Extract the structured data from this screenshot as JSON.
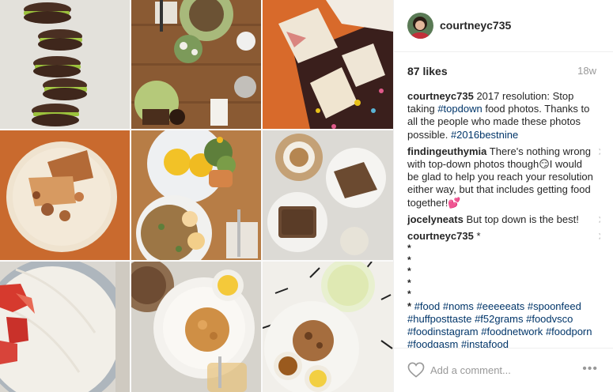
{
  "post": {
    "username": "courtneyc735",
    "likes": "87 likes",
    "age": "18w"
  },
  "grid": {
    "photos": [
      {
        "icon": "cookie-sandwich-photo"
      },
      {
        "icon": "table-spread-photo"
      },
      {
        "icon": "patterned-cards-photo"
      },
      {
        "icon": "dessert-plate-photo"
      },
      {
        "icon": "eggs-benedict-photo"
      },
      {
        "icon": "latte-toast-photo"
      },
      {
        "icon": "strawberry-cake-photo"
      },
      {
        "icon": "scone-plate-photo"
      },
      {
        "icon": "lemonade-cookie-photo"
      }
    ]
  },
  "comments": {
    "caption": {
      "user": "courtneyc735",
      "text_1": "2017 resolution: Stop taking",
      "tag_1": "#topdown",
      "text_2": "food photos. Thanks to all the people who made these photos possible.",
      "tag_2": "#2016bestnine"
    },
    "c1": {
      "user": "findingeuthymia",
      "text_1": "There's nothing wrong with top-down photos though",
      "emoji_1": "😏",
      "text_2": "I would be glad to help you reach your resolution either way, but that includes getting food together!",
      "emoji_2": "💕"
    },
    "c2": {
      "user": "jocelyneats",
      "text": "But top down is the best!"
    },
    "c3": {
      "user": "courtneyc735",
      "text": "*",
      "dots": [
        "*",
        "*",
        "*",
        "*",
        "*"
      ],
      "tags_lead": "*",
      "tags": [
        "#food",
        "#noms",
        "#eeeeeats",
        "#spoonfeed",
        "#huffposttaste",
        "#f52grams",
        "#foodvsco",
        "#foodinstagram",
        "#foodnetwork",
        "#foodporn",
        "#foodgasm",
        "#instafood"
      ]
    },
    "close_glyph": "✕"
  },
  "footer": {
    "placeholder": "Add a comment...",
    "more": "•••"
  },
  "colors": {
    "link": "#003569",
    "muted": "#999999",
    "divider": "#efefef"
  }
}
